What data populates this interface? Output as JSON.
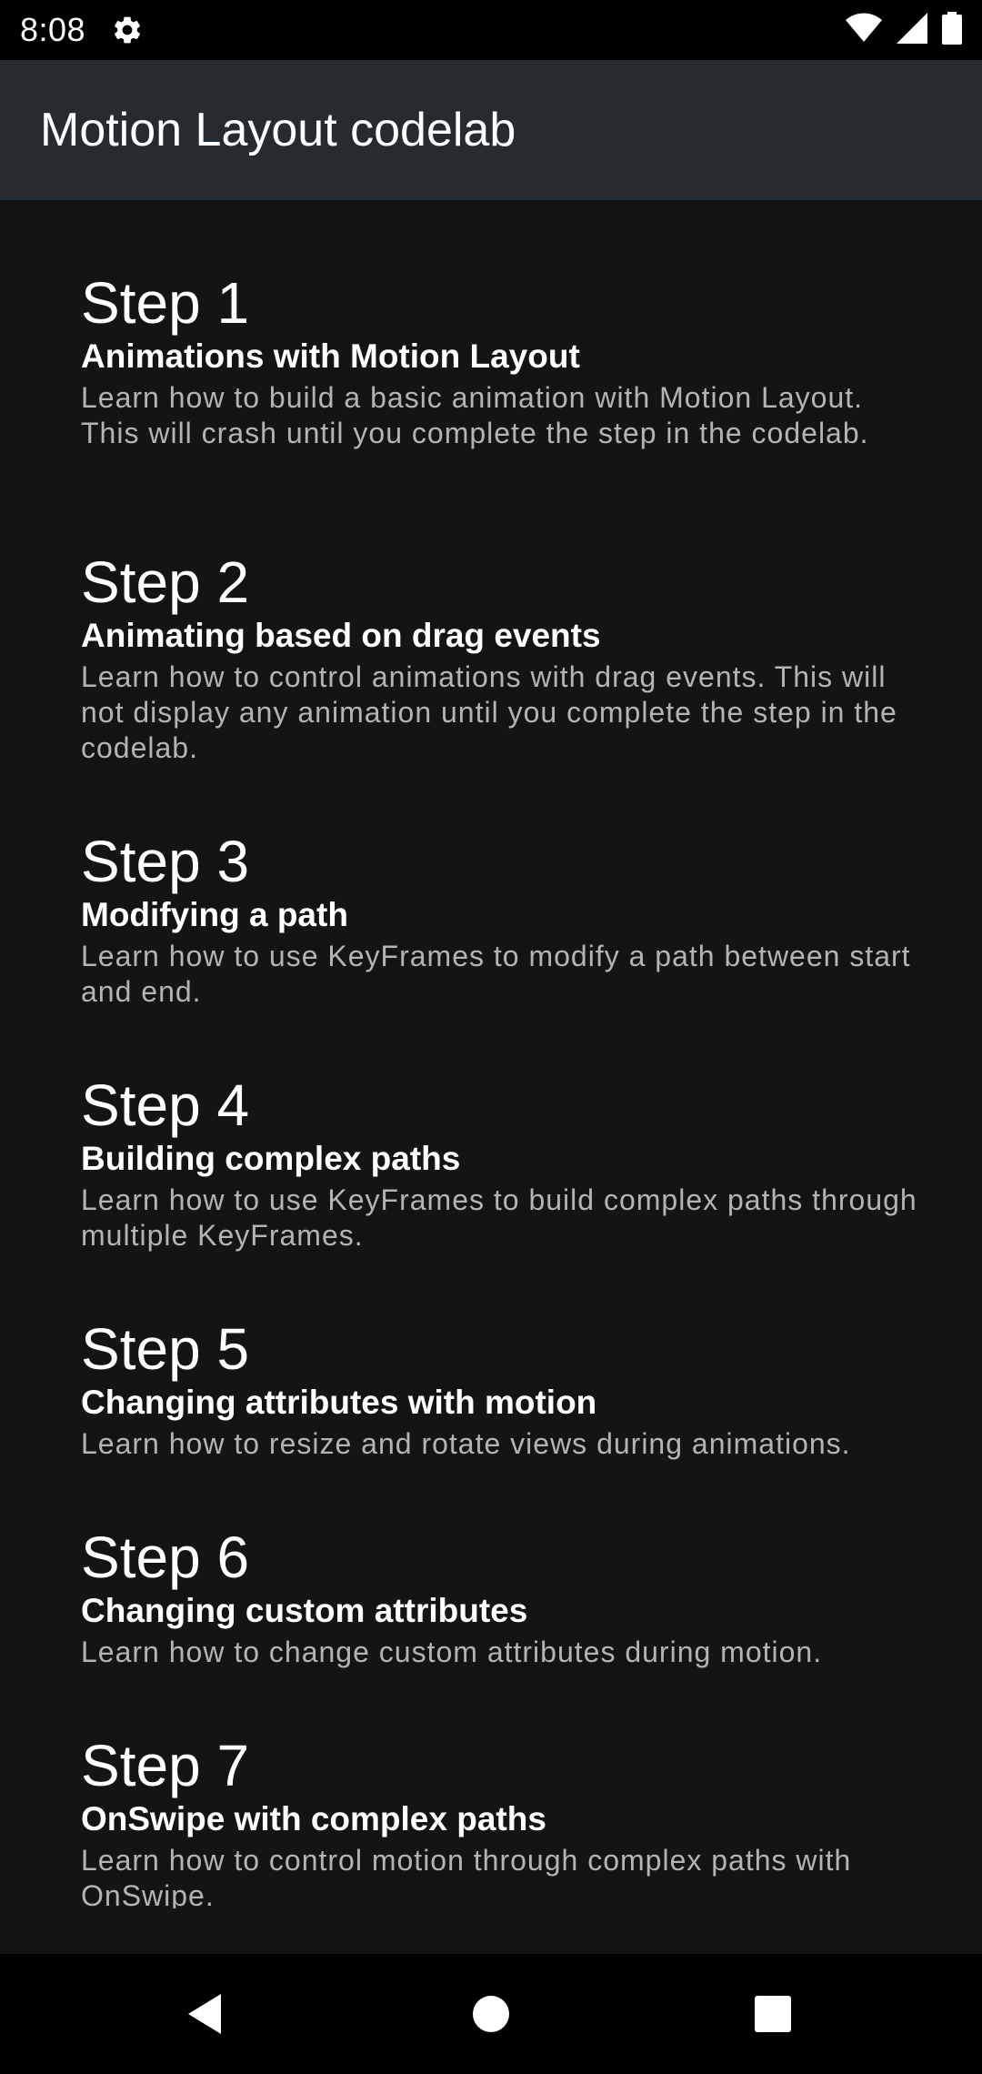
{
  "status_bar": {
    "time": "8:08",
    "icons": [
      "gear-icon",
      "wifi-icon",
      "signal-icon",
      "battery-icon"
    ]
  },
  "app_bar": {
    "title": "Motion Layout codelab"
  },
  "steps": [
    {
      "title": "Step 1",
      "subtitle": "Animations with Motion Layout",
      "description": "Learn how to build a basic animation with Motion Layout. This will crash until you complete the step in the codelab."
    },
    {
      "title": "Step 2",
      "subtitle": "Animating based on drag events",
      "description": "Learn how to control animations with drag events. This will not display any animation until you complete the step in the codelab."
    },
    {
      "title": "Step 3",
      "subtitle": "Modifying a path",
      "description": "Learn how to use KeyFrames to modify a path between start and end."
    },
    {
      "title": "Step 4",
      "subtitle": "Building complex paths",
      "description": "Learn how to use KeyFrames to build complex paths through multiple KeyFrames."
    },
    {
      "title": "Step 5",
      "subtitle": "Changing attributes with motion",
      "description": "Learn how to resize and rotate views during animations."
    },
    {
      "title": "Step 6",
      "subtitle": "Changing custom attributes",
      "description": "Learn how to change custom attributes during motion."
    },
    {
      "title": "Step 7",
      "subtitle": "OnSwipe with complex paths",
      "description": "Learn how to control motion through complex paths with OnSwipe."
    }
  ],
  "nav_bar": {
    "icons": [
      "back-icon",
      "home-icon",
      "recents-icon"
    ]
  },
  "colors": {
    "background": "#141415",
    "app_bar": "#262b30",
    "status_bar": "#000000",
    "text_primary": "#ffffff",
    "text_secondary": "#b4b4b4"
  }
}
